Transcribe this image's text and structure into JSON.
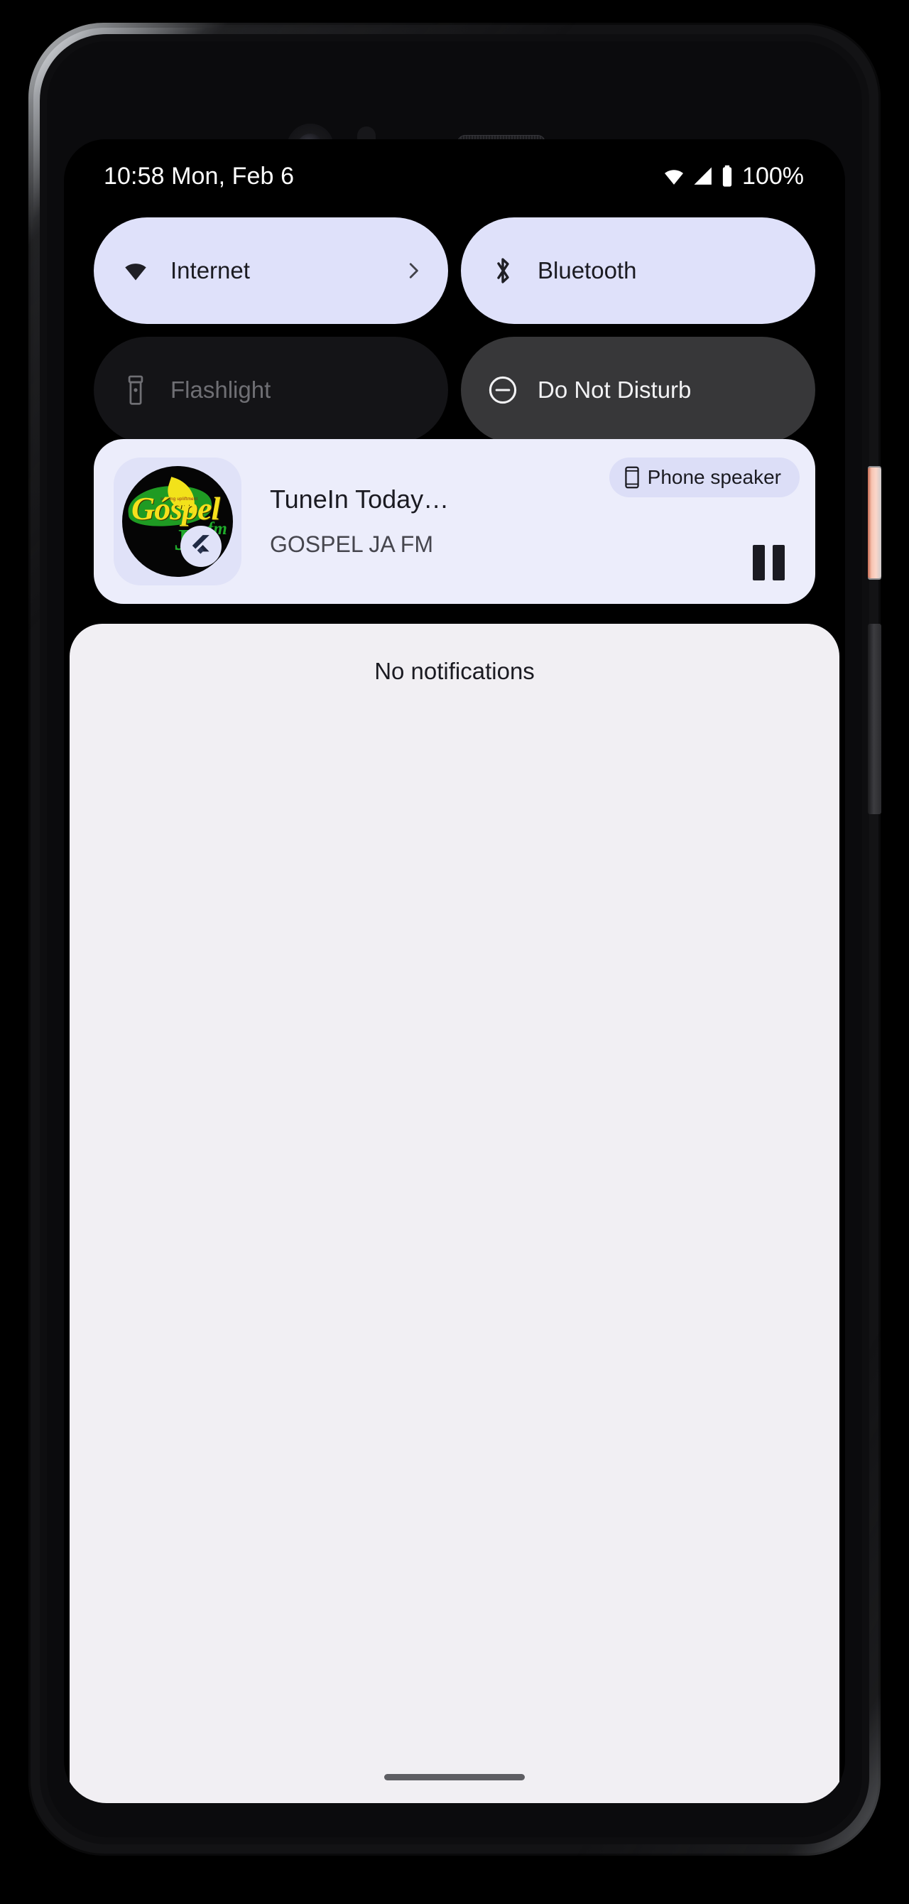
{
  "device": {
    "hardware": {
      "front_camera": "front-camera-icon",
      "proximity_sensor": "proximity-sensor",
      "earpiece": "earpiece-speaker",
      "power_button": "power-button",
      "volume_rocker": "volume-rocker"
    }
  },
  "status_bar": {
    "clock": "10:58 Mon, Feb 6",
    "battery_percent": "100%",
    "icons": [
      "wifi-icon",
      "cellular-signal-icon",
      "battery-icon"
    ]
  },
  "quick_settings": {
    "tiles": [
      {
        "label": "Internet",
        "icon": "wifi-icon",
        "state": "active",
        "has_chevron": true,
        "chevron_icon": "chevron-right-icon"
      },
      {
        "label": "Bluetooth",
        "icon": "bluetooth-icon",
        "state": "active",
        "has_chevron": false
      },
      {
        "label": "Flashlight",
        "icon": "flashlight-icon",
        "state": "disabled",
        "has_chevron": false
      },
      {
        "label": "Do Not Disturb",
        "icon": "do-not-disturb-icon",
        "state": "inactive",
        "has_chevron": false
      }
    ]
  },
  "media_player": {
    "title": "TuneIn Today…",
    "subtitle": "GOSPEL JA FM",
    "output_device": "Phone speaker",
    "output_icon": "phone-speaker-icon",
    "playback_control": "pause-icon",
    "playback_state": "playing",
    "album_art": {
      "name": "gospel-ja-fm-logo",
      "word_main": "Góspel",
      "word_sub": "Ja",
      "word_fm": "fm",
      "tagline": "serving upliftment"
    },
    "app_badge": "flutter-logo-icon"
  },
  "notification_shade": {
    "empty_text": "No notifications",
    "home_indicator": "home-indicator-bar"
  },
  "colors": {
    "tile_active_bg": "#dfe1fa",
    "tile_inactive_bg": "#373739",
    "tile_disabled_bg": "#141417",
    "media_card_bg": "#ecedfb",
    "output_chip_bg": "#dcdef7",
    "shade_bg": "#f1eff3",
    "screen_bg": "#000000",
    "on_light_text": "#1b1b22",
    "power_button": "#f7c3b1",
    "logo_yellow": "#f7e01c",
    "logo_green": "#1faa2b"
  }
}
